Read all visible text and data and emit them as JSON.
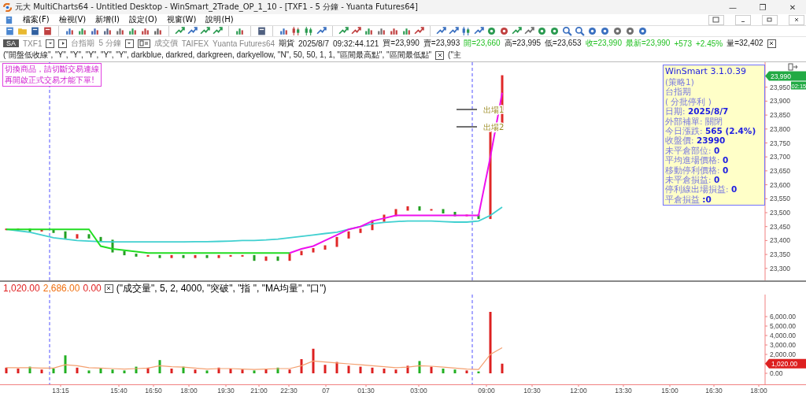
{
  "window": {
    "title": "元大 MultiCharts64 - Untitled Desktop - WinSmart_2Trade_OP_1_10 - [TXF1 - 5 分鐘 - Yuanta Futures64]",
    "controls": [
      "—",
      "❐",
      "✕"
    ]
  },
  "menu": [
    "檔案(F)",
    "檢視(V)",
    "新增(I)",
    "設定(O)",
    "視窗(W)",
    "說明(H)"
  ],
  "symbol_bar": {
    "badge": "SA",
    "symbol": "TXF1",
    "name": "台指期",
    "interval": "5 分鐘",
    "field": "成交價",
    "exchange": "TAIFEX",
    "feed": "Yuanta Futures64",
    "type": "期貨",
    "date": "2025/8/7",
    "time": "09:32:44.121",
    "quotes": [
      {
        "text": "買=23,990",
        "color": "#202020"
      },
      {
        "text": "賣=23,993",
        "color": "#202020"
      },
      {
        "text": "開=23,660",
        "color": "#22c022"
      },
      {
        "text": "高=23,995",
        "color": "#202020"
      },
      {
        "text": "低=23,653",
        "color": "#202020"
      },
      {
        "text": "收=23,990",
        "color": "#22c022"
      },
      {
        "text": "最新=23,990",
        "color": "#22c022"
      },
      {
        "text": "+573",
        "color": "#22c022"
      },
      {
        "text": "+2.45%",
        "color": "#22c022"
      },
      {
        "text": "量=32,402",
        "color": "#202020"
      }
    ],
    "study": "(\"開盤低收線\", \"Y\", \"Y\", \"Y\", \"Y\", \"Y\", darkblue, darkred, darkgreen, darkyellow, \"N\", 50, 50, 1, 1, \"區間最高點\", \"區間最低點\"",
    "study_2": "(\"主"
  },
  "notice": [
    "切換商品，請切斷交易連線",
    "再開啟正式交易才能下單!"
  ],
  "info_panel": {
    "title": "WinSmart 3.1.0.39",
    "lines": [
      "(策略1)",
      "台指期",
      "( 分批停利 )",
      "日期: **2025/8/7**",
      "外部補單: 關閉",
      "今日漲跌: **565 (2.4%)**",
      "收盤價: **23990**",
      "未平倉部位: **0**",
      "平均進場價格: **0**",
      "移動停利價格: **0**",
      "未平倉損益: **0**",
      "停利線出場損益: **0**",
      "平倉損益 **:0**"
    ]
  },
  "price_chart": {
    "last_price": "23,990",
    "countdown": "02:15",
    "exit_markers": [
      "出場1",
      "出場2"
    ],
    "axis_labels": [
      "23,950",
      "23,900",
      "23,850",
      "23,800",
      "23,750",
      "23,700",
      "23,650",
      "23,600",
      "23,550",
      "23,500",
      "23,450",
      "23,400",
      "23,350",
      "23,300"
    ]
  },
  "volume_chart": {
    "readings": [
      {
        "text": "1,020.00",
        "color": "#e02020"
      },
      {
        "text": "2,686.00",
        "color": "#f07010"
      },
      {
        "text": "0.00",
        "color": "#e02020"
      }
    ],
    "study": "(\"成交量\", 5, 2, 4000, \"突破\", \"指 \", \"MA均量\", \"口\")",
    "last_value": "1,020.00",
    "axis_labels": [
      "6,000.00",
      "5,000.00",
      "4,000.00",
      "3,000.00",
      "2,000.00",
      "0.00"
    ]
  },
  "time_axis": [
    "13:15",
    "15:40",
    "16:50",
    "18:00",
    "19:30",
    "21:00",
    "22:30",
    "07",
    "01:30",
    "03:00",
    "09:00",
    "10:30",
    "12:00",
    "13:30",
    "15:00",
    "16:30",
    "18:00"
  ]
}
